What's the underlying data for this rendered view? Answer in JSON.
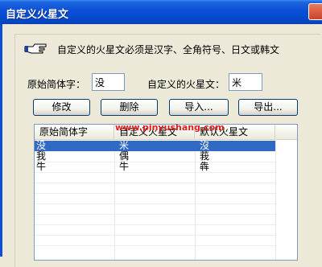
{
  "window": {
    "title": "自定义火星文"
  },
  "info": {
    "text": "自定义的火星文必须是汉字、全角符号、日文或韩文"
  },
  "form": {
    "original_label": "原始简体字：",
    "original_value": "没",
    "custom_label": "自定义的火星文：",
    "custom_value": "米"
  },
  "buttons": {
    "modify": "修改",
    "delete": "删除",
    "import": "导入...",
    "export": "导出..."
  },
  "table": {
    "columns": [
      "原始简体字",
      "自定义火星文",
      "默认火星文"
    ],
    "rows": [
      [
        "没",
        "米",
        "沒"
      ],
      [
        "我",
        "偶",
        "莪"
      ],
      [
        "牛",
        "牛",
        "犇"
      ]
    ],
    "selected_row": 0
  },
  "watermark": "www.pinyushang.com",
  "colors": {
    "titlebar": "#0a4fd6",
    "selection": "#316ac5",
    "watermark": "#e02020"
  },
  "icons": {
    "hand": "pointing-hand-icon",
    "close": "close-icon"
  }
}
